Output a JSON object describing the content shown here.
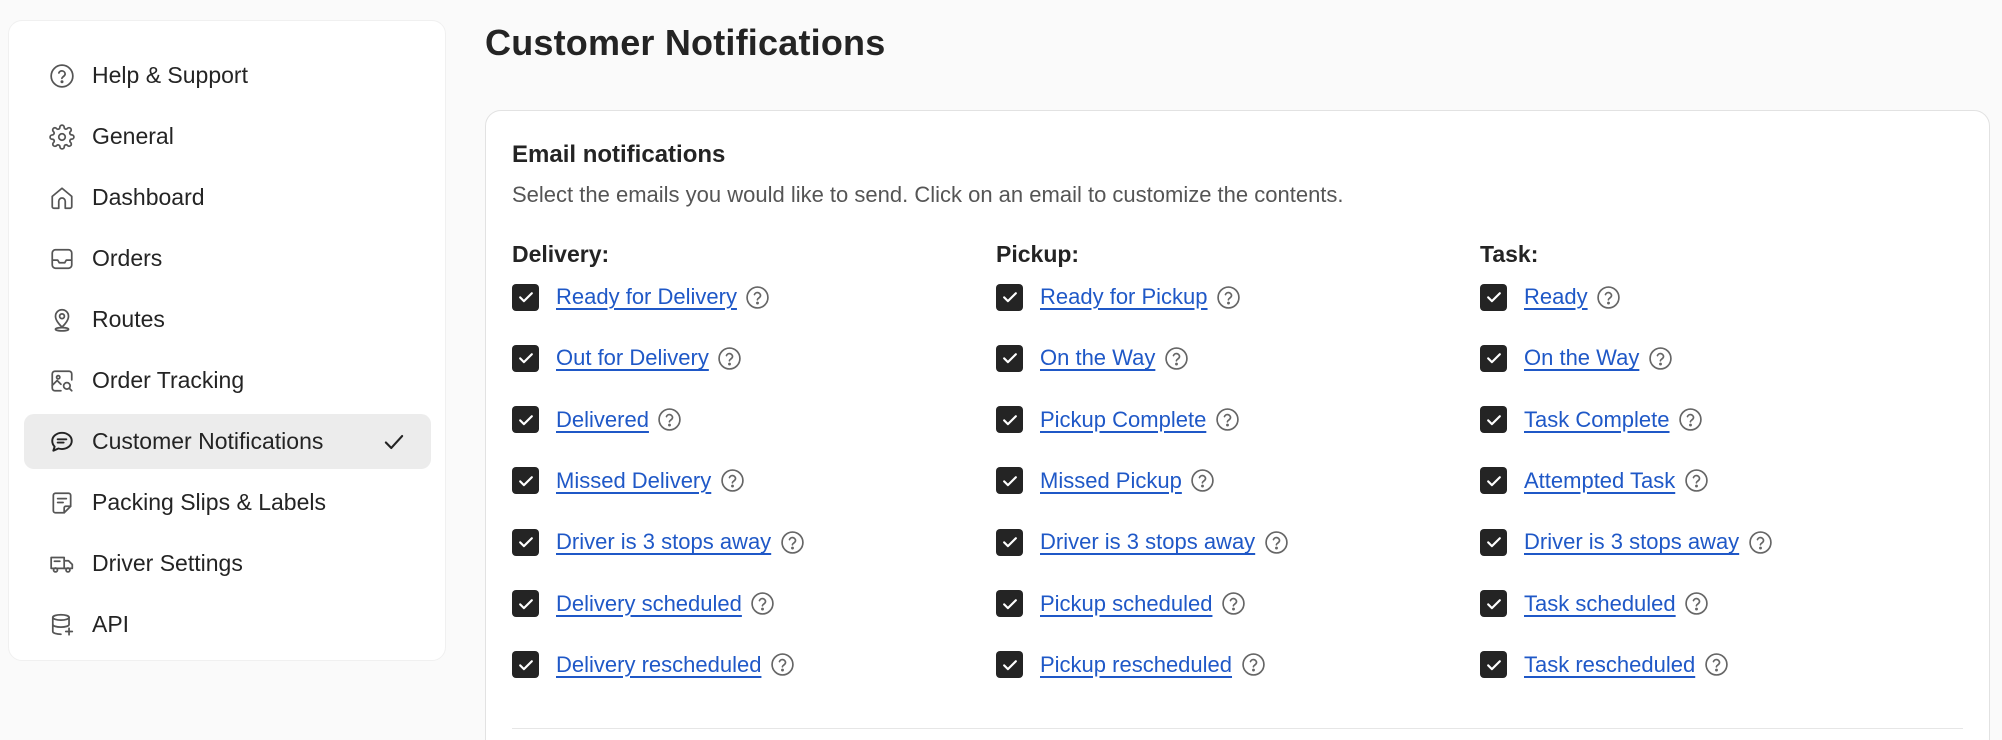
{
  "sidebar": {
    "items": [
      {
        "label": "Help & Support",
        "icon": "help-circle-icon"
      },
      {
        "label": "General",
        "icon": "gear-icon"
      },
      {
        "label": "Dashboard",
        "icon": "home-icon"
      },
      {
        "label": "Orders",
        "icon": "inbox-icon"
      },
      {
        "label": "Routes",
        "icon": "map-pin-icon"
      },
      {
        "label": "Order Tracking",
        "icon": "image-search-icon"
      },
      {
        "label": "Customer Notifications",
        "icon": "chat-bubble-icon",
        "active": true
      },
      {
        "label": "Packing Slips & Labels",
        "icon": "document-icon"
      },
      {
        "label": "Driver Settings",
        "icon": "truck-icon"
      },
      {
        "label": "API",
        "icon": "database-icon"
      }
    ]
  },
  "page": {
    "title": "Customer Notifications"
  },
  "email": {
    "title": "Email notifications",
    "description": "Select the emails you would like to send. Click on an email to customize the contents.",
    "columns": [
      {
        "heading": "Delivery:",
        "items": [
          {
            "label": "Ready for Delivery",
            "checked": true
          },
          {
            "label": "Out for Delivery",
            "checked": true
          },
          {
            "label": "Delivered",
            "checked": true
          },
          {
            "label": "Missed Delivery",
            "checked": true
          },
          {
            "label": "Driver is 3 stops away",
            "checked": true
          },
          {
            "label": "Delivery scheduled",
            "checked": true
          },
          {
            "label": "Delivery rescheduled",
            "checked": true
          }
        ]
      },
      {
        "heading": "Pickup:",
        "items": [
          {
            "label": "Ready for Pickup",
            "checked": true
          },
          {
            "label": "On the Way",
            "checked": true
          },
          {
            "label": "Pickup Complete",
            "checked": true
          },
          {
            "label": "Missed Pickup",
            "checked": true
          },
          {
            "label": "Driver is 3 stops away",
            "checked": true
          },
          {
            "label": "Pickup scheduled",
            "checked": true
          },
          {
            "label": "Pickup rescheduled",
            "checked": true
          }
        ]
      },
      {
        "heading": "Task:",
        "items": [
          {
            "label": "Ready",
            "checked": true
          },
          {
            "label": "On the Way",
            "checked": true
          },
          {
            "label": "Task Complete",
            "checked": true
          },
          {
            "label": "Attempted Task",
            "checked": true
          },
          {
            "label": "Driver is 3 stops away",
            "checked": true
          },
          {
            "label": "Task scheduled",
            "checked": true
          },
          {
            "label": "Task rescheduled",
            "checked": true
          }
        ]
      }
    ]
  },
  "colors": {
    "link": "#1f58c7",
    "checkbox": "#242424",
    "active_nav": "#ececec"
  }
}
